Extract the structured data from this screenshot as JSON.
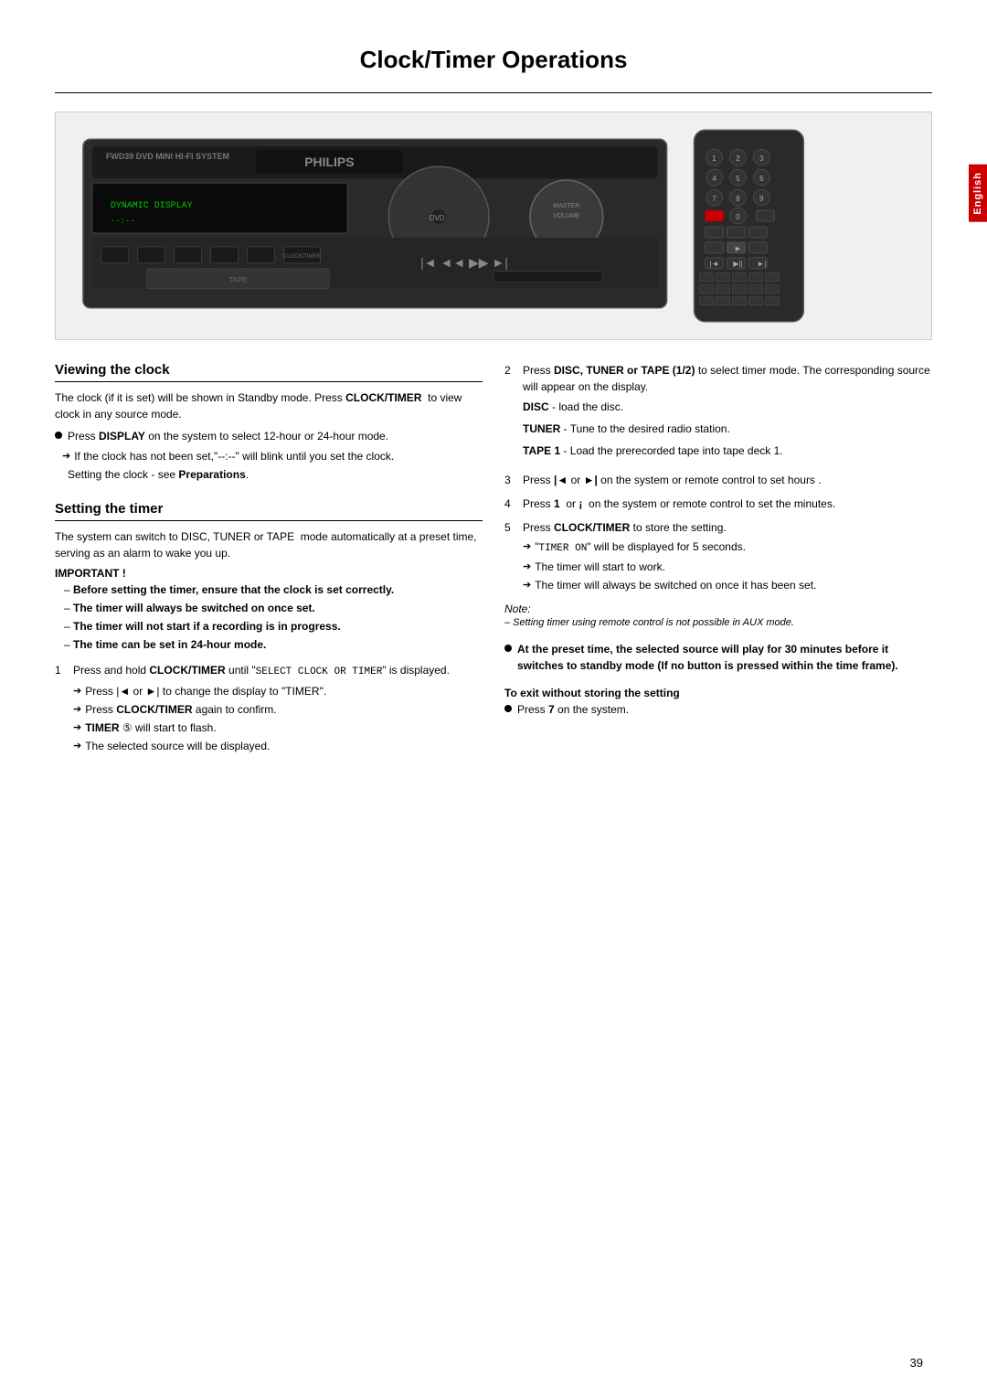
{
  "page": {
    "title": "Clock/Timer Operations",
    "language_tab": "English",
    "page_number": "39"
  },
  "viewing_clock": {
    "heading": "Viewing the clock",
    "intro": "The clock (if it is set) will be shown in Standby mode. Press CLOCK/TIMER  to view clock in any source mode.",
    "bullet1_text": "Press DISPLAY on the system to select 12-hour or 24-hour mode.",
    "arrow1": "If the clock has not been set,\"--:--\" will blink until you set the clock.",
    "setting_clock_ref": "Setting the clock - see Preparations."
  },
  "setting_timer": {
    "heading": "Setting the timer",
    "intro": "The system can switch to DISC, TUNER or TAPE  mode automatically at a preset time, serving as an alarm to wake you up.",
    "important_label": "IMPORTANT !",
    "dash1": "Before setting the timer, ensure that the clock is set correctly.",
    "dash2": "The timer will always be switched on once set.",
    "dash3": "The timer will not start if a recording is in progress.",
    "dash4": "The time can be set in 24-hour mode.",
    "step1_num": "1",
    "step1_text": "Press and hold CLOCK/TIMER until \"SELECT CLOCK OR TIMER\" is displayed.",
    "step1_arrow1": "Press |◄ or ►| to change the display to \"TIMER\".",
    "step1_arrow2": "Press CLOCK/TIMER again to confirm.",
    "step1_arrow3": "TIMER ⑤ will start to flash.",
    "step1_arrow4": "The selected source will be displayed."
  },
  "right_column": {
    "step2_num": "2",
    "step2_text": "Press DISC, TUNER or TAPE (1/2) to select timer mode. The corresponding source will appear on the display.",
    "disc_label": "DISC",
    "disc_text": "- load the disc.",
    "tuner_label": "TUNER",
    "tuner_text": "- Tune to the desired radio station.",
    "tape_label": "TAPE 1",
    "tape_text": "- Load the prerecorded tape into tape deck 1.",
    "step3_num": "3",
    "step3_text": "Press |◄ or ►| on the system or remote control to set hours .",
    "step4_num": "4",
    "step4_text": "Press 1  or ¡  on the system or remote control to set the minutes.",
    "step5_num": "5",
    "step5_text": "Press CLOCK/TIMER to store the setting.",
    "step5_arrow1": "\"TIMER ON\" will be displayed for 5 seconds.",
    "step5_arrow2": "The timer will start to work.",
    "step5_arrow3": "The timer will always be switched on once it has been set.",
    "note_label": "Note:",
    "note_text": "– Setting timer using remote control is not possible in AUX mode.",
    "bullet2_text": "At the preset time, the selected source will play for 30 minutes before it switches to standby mode (If no button is pressed within the time frame).",
    "exit_heading": "To exit without storing the setting",
    "exit_text": "Press 7 on the system."
  }
}
